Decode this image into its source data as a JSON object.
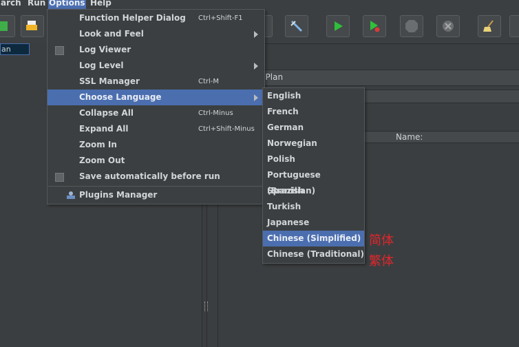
{
  "menubar": {
    "items": [
      {
        "label": "arch"
      },
      {
        "label": "Run"
      },
      {
        "label": "Options"
      },
      {
        "label": "Help"
      }
    ]
  },
  "tree": {
    "selected_item": "an"
  },
  "editor": {
    "title_fragment": "t Plan",
    "name_header": "Name:"
  },
  "options_menu": {
    "items": [
      {
        "label": "Function Helper Dialog",
        "shortcut": "Ctrl+Shift-F1"
      },
      {
        "label": "Look and Feel"
      },
      {
        "label": "Log Viewer"
      },
      {
        "label": "Log Level"
      },
      {
        "label": "SSL Manager",
        "shortcut": "Ctrl-M"
      },
      {
        "label": "Choose Language"
      },
      {
        "label": "Collapse All",
        "shortcut": "Ctrl-Minus"
      },
      {
        "label": "Expand All",
        "shortcut": "Ctrl+Shift-Minus"
      },
      {
        "label": "Zoom In"
      },
      {
        "label": "Zoom Out"
      },
      {
        "label": "Save automatically before run"
      },
      {
        "label": "Plugins Manager"
      }
    ]
  },
  "language_menu": {
    "items": [
      {
        "label": "English"
      },
      {
        "label": "French"
      },
      {
        "label": "German"
      },
      {
        "label": "Norwegian"
      },
      {
        "label": "Polish"
      },
      {
        "label": "Portuguese (Brazilian)"
      },
      {
        "label": "Spanish"
      },
      {
        "label": "Turkish"
      },
      {
        "label": "Japanese"
      },
      {
        "label": "Chinese (Simplified)"
      },
      {
        "label": "Chinese (Traditional)"
      }
    ]
  },
  "annotations": {
    "simplified": "简体",
    "traditional": "繁体"
  },
  "colors": {
    "accent": "#4b6eaf",
    "background": "#3c3f41",
    "annotation": "#e0262b"
  }
}
